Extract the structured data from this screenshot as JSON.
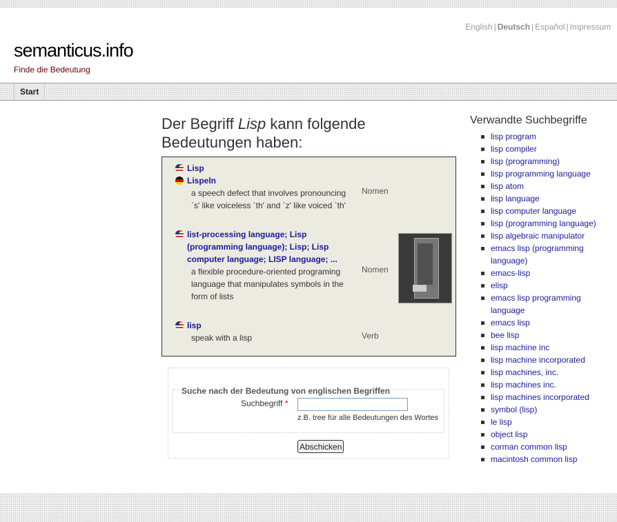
{
  "languages": [
    {
      "label": "English",
      "current": false
    },
    {
      "label": "Deutsch",
      "current": true
    },
    {
      "label": "Español",
      "current": false
    },
    {
      "label": "Impressum",
      "current": false
    }
  ],
  "site": {
    "logo": "semanticus.info",
    "tagline": "Finde die Bedeutung"
  },
  "nav": {
    "start": "Start"
  },
  "heading": {
    "before": "Der Begriff ",
    "term": "Lisp",
    "after": " kann folgende Bedeutungen haben:"
  },
  "results": {
    "entries": [
      {
        "flag": "us",
        "term": "Lisp"
      },
      {
        "flag": "de",
        "term": "Lispeln"
      },
      {
        "definition_lines": [
          "a speech defect that involves pronouncing",
          "`s' like voiceless `th' and `z' like voiced `th'"
        ],
        "pos": "Nomen"
      },
      {
        "flag": "us",
        "term_lines": [
          "list-processing language; Lisp",
          "(programming language); Lisp; Lisp",
          "computer language; LISP language; ..."
        ]
      },
      {
        "definition_lines": [
          "a flexible procedure-oriented programing",
          "language that manipulates symbols in the",
          "form of lists"
        ],
        "pos": "Nomen"
      },
      {
        "flag": "us",
        "term": "lisp"
      },
      {
        "definition_lines": [
          "speak with a lisp"
        ],
        "pos": "Verb"
      }
    ]
  },
  "search": {
    "legend": "Suche nach der Bedeutung von englischen Begriffen",
    "label": "Suchbegriff",
    "required_mark": "*",
    "value": "",
    "hint_prefix": "z.B. ",
    "hint_example": "tree",
    "hint_suffix": " für alle Bedeutungen des Wortes",
    "submit": "Abschicken"
  },
  "related": {
    "title": "Verwandte Suchbegriffe",
    "items": [
      "lisp program",
      "lisp compiler",
      "lisp (programming)",
      "lisp programming language",
      "lisp atom",
      "lisp language",
      "lisp computer language",
      "lisp (programming language)",
      "lisp algebraic manipulator",
      "emacs lisp (programming language)",
      "emacs-lisp",
      "elisp",
      "emacs lisp programming language",
      "emacs lisp",
      "bee lisp",
      "lisp machine inc",
      "lisp machine incorporated",
      "lisp machines, inc.",
      "lisp machines inc.",
      "lisp machines incorporated",
      "symbol (lisp)",
      "le lisp",
      "object lisp",
      "corman common lisp",
      "macintosh common lisp"
    ]
  }
}
